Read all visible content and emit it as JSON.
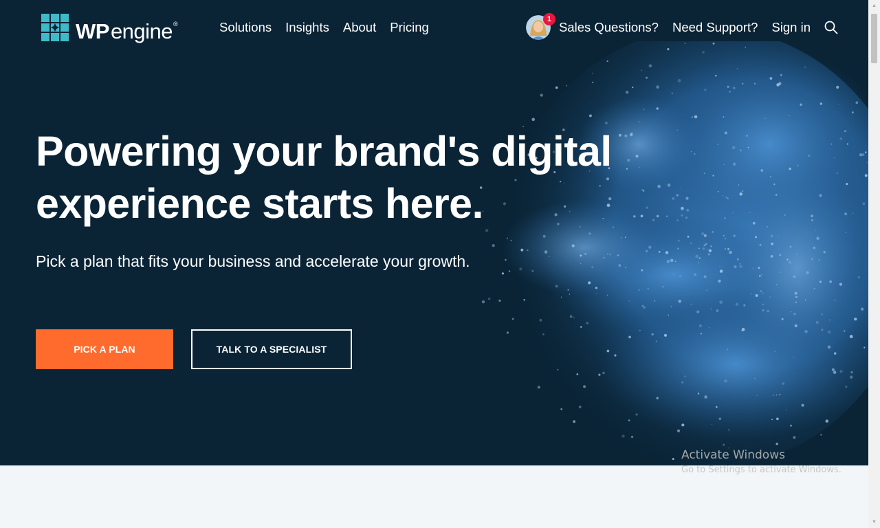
{
  "brand": {
    "logo_bold": "WP",
    "logo_regular": "engine",
    "logo_mark": "®",
    "logo_icon": "wpengine-logo-icon"
  },
  "nav": {
    "items": [
      "Solutions",
      "Insights",
      "About",
      "Pricing"
    ]
  },
  "utility_nav": {
    "notification_count": "1",
    "sales": "Sales Questions?",
    "support": "Need Support?",
    "signin": "Sign in",
    "search_icon": "search-icon"
  },
  "hero": {
    "headline": "Powering your brand's digital experience starts here.",
    "subhead": "Pick a plan that fits your business and accelerate your growth.",
    "primary_cta": "PICK A PLAN",
    "secondary_cta": "TALK TO A SPECIALIST"
  },
  "watermark": {
    "title": "Activate Windows",
    "subtitle": "Go to Settings to activate Windows."
  },
  "colors": {
    "hero_bg": "#0a2436",
    "accent_orange": "#ff6b2c",
    "logo_teal": "#40bac8",
    "badge_red": "#e8173e",
    "powder_blue": "#2f6fae"
  }
}
